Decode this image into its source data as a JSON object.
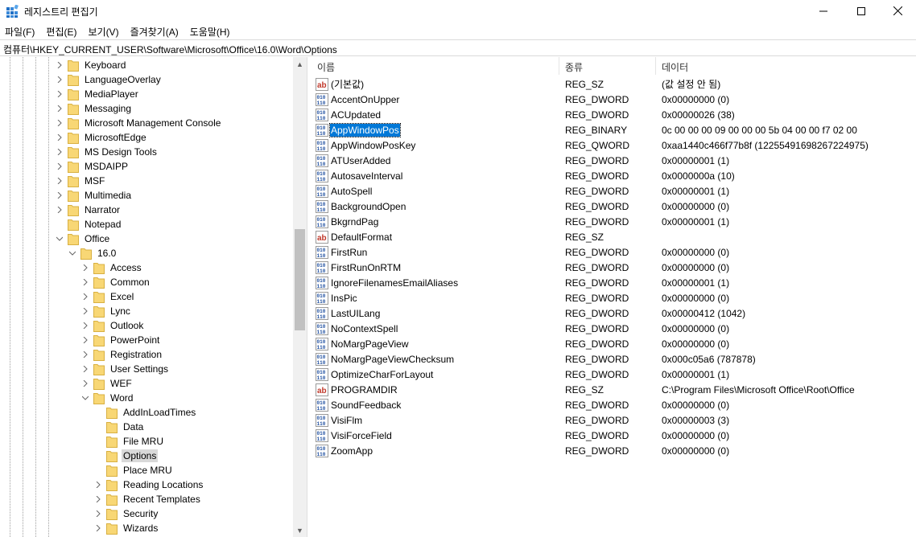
{
  "window": {
    "title": "레지스트리 편집기"
  },
  "menu": {
    "items": [
      "파일(F)",
      "편집(E)",
      "보기(V)",
      "즐겨찾기(A)",
      "도움말(H)"
    ]
  },
  "address": "컴퓨터\\HKEY_CURRENT_USER\\Software\\Microsoft\\Office\\16.0\\Word\\Options",
  "tree": {
    "items": [
      {
        "label": "Keyboard",
        "level": 0,
        "expander": "collapsed"
      },
      {
        "label": "LanguageOverlay",
        "level": 0,
        "expander": "collapsed"
      },
      {
        "label": "MediaPlayer",
        "level": 0,
        "expander": "collapsed"
      },
      {
        "label": "Messaging",
        "level": 0,
        "expander": "collapsed"
      },
      {
        "label": "Microsoft Management Console",
        "level": 0,
        "expander": "collapsed"
      },
      {
        "label": "MicrosoftEdge",
        "level": 0,
        "expander": "collapsed"
      },
      {
        "label": "MS Design Tools",
        "level": 0,
        "expander": "collapsed"
      },
      {
        "label": "MSDAIPP",
        "level": 0,
        "expander": "collapsed"
      },
      {
        "label": "MSF",
        "level": 0,
        "expander": "collapsed"
      },
      {
        "label": "Multimedia",
        "level": 0,
        "expander": "collapsed"
      },
      {
        "label": "Narrator",
        "level": 0,
        "expander": "collapsed"
      },
      {
        "label": "Notepad",
        "level": 0,
        "expander": "none"
      },
      {
        "label": "Office",
        "level": 0,
        "expander": "expanded"
      },
      {
        "label": "16.0",
        "level": 1,
        "expander": "expanded"
      },
      {
        "label": "Access",
        "level": 2,
        "expander": "collapsed"
      },
      {
        "label": "Common",
        "level": 2,
        "expander": "collapsed"
      },
      {
        "label": "Excel",
        "level": 2,
        "expander": "collapsed"
      },
      {
        "label": "Lync",
        "level": 2,
        "expander": "collapsed"
      },
      {
        "label": "Outlook",
        "level": 2,
        "expander": "collapsed"
      },
      {
        "label": "PowerPoint",
        "level": 2,
        "expander": "collapsed"
      },
      {
        "label": "Registration",
        "level": 2,
        "expander": "collapsed"
      },
      {
        "label": "User Settings",
        "level": 2,
        "expander": "collapsed"
      },
      {
        "label": "WEF",
        "level": 2,
        "expander": "collapsed"
      },
      {
        "label": "Word",
        "level": 2,
        "expander": "expanded"
      },
      {
        "label": "AddInLoadTimes",
        "level": 3,
        "expander": "none"
      },
      {
        "label": "Data",
        "level": 3,
        "expander": "none"
      },
      {
        "label": "File MRU",
        "level": 3,
        "expander": "none"
      },
      {
        "label": "Options",
        "level": 3,
        "expander": "none",
        "selected": true
      },
      {
        "label": "Place MRU",
        "level": 3,
        "expander": "none"
      },
      {
        "label": "Reading Locations",
        "level": 3,
        "expander": "collapsed"
      },
      {
        "label": "Recent Templates",
        "level": 3,
        "expander": "collapsed"
      },
      {
        "label": "Security",
        "level": 3,
        "expander": "collapsed"
      },
      {
        "label": "Wizards",
        "level": 3,
        "expander": "collapsed"
      }
    ]
  },
  "list": {
    "headers": {
      "name": "이름",
      "type": "종류",
      "data": "데이터"
    },
    "rows": [
      {
        "icon": "string-value-icon",
        "name": "(기본값)",
        "type": "REG_SZ",
        "data": "(값 설정 안 됨)"
      },
      {
        "icon": "binary-value-icon",
        "name": "AccentOnUpper",
        "type": "REG_DWORD",
        "data": "0x00000000 (0)"
      },
      {
        "icon": "binary-value-icon",
        "name": "ACUpdated",
        "type": "REG_DWORD",
        "data": "0x00000026 (38)"
      },
      {
        "icon": "binary-value-icon",
        "name": "AppWindowPos",
        "type": "REG_BINARY",
        "data": "0c 00 00 00 09 00 00 00 5b 04 00 00 f7 02 00",
        "selected": true
      },
      {
        "icon": "binary-value-icon",
        "name": "AppWindowPosKey",
        "type": "REG_QWORD",
        "data": "0xaa1440c466f77b8f (12255491698267224975)"
      },
      {
        "icon": "binary-value-icon",
        "name": "ATUserAdded",
        "type": "REG_DWORD",
        "data": "0x00000001 (1)"
      },
      {
        "icon": "binary-value-icon",
        "name": "AutosaveInterval",
        "type": "REG_DWORD",
        "data": "0x0000000a (10)"
      },
      {
        "icon": "binary-value-icon",
        "name": "AutoSpell",
        "type": "REG_DWORD",
        "data": "0x00000001 (1)"
      },
      {
        "icon": "binary-value-icon",
        "name": "BackgroundOpen",
        "type": "REG_DWORD",
        "data": "0x00000000 (0)"
      },
      {
        "icon": "binary-value-icon",
        "name": "BkgrndPag",
        "type": "REG_DWORD",
        "data": "0x00000001 (1)"
      },
      {
        "icon": "string-value-icon",
        "name": "DefaultFormat",
        "type": "REG_SZ",
        "data": ""
      },
      {
        "icon": "binary-value-icon",
        "name": "FirstRun",
        "type": "REG_DWORD",
        "data": "0x00000000 (0)"
      },
      {
        "icon": "binary-value-icon",
        "name": "FirstRunOnRTM",
        "type": "REG_DWORD",
        "data": "0x00000000 (0)"
      },
      {
        "icon": "binary-value-icon",
        "name": "IgnoreFilenamesEmailAliases",
        "type": "REG_DWORD",
        "data": "0x00000001 (1)"
      },
      {
        "icon": "binary-value-icon",
        "name": "InsPic",
        "type": "REG_DWORD",
        "data": "0x00000000 (0)"
      },
      {
        "icon": "binary-value-icon",
        "name": "LastUILang",
        "type": "REG_DWORD",
        "data": "0x00000412 (1042)"
      },
      {
        "icon": "binary-value-icon",
        "name": "NoContextSpell",
        "type": "REG_DWORD",
        "data": "0x00000000 (0)"
      },
      {
        "icon": "binary-value-icon",
        "name": "NoMargPageView",
        "type": "REG_DWORD",
        "data": "0x00000000 (0)"
      },
      {
        "icon": "binary-value-icon",
        "name": "NoMargPageViewChecksum",
        "type": "REG_DWORD",
        "data": "0x000c05a6 (787878)"
      },
      {
        "icon": "binary-value-icon",
        "name": "OptimizeCharForLayout",
        "type": "REG_DWORD",
        "data": "0x00000001 (1)"
      },
      {
        "icon": "string-value-icon",
        "name": "PROGRAMDIR",
        "type": "REG_SZ",
        "data": "C:\\Program Files\\Microsoft Office\\Root\\Office"
      },
      {
        "icon": "binary-value-icon",
        "name": "SoundFeedback",
        "type": "REG_DWORD",
        "data": "0x00000000 (0)"
      },
      {
        "icon": "binary-value-icon",
        "name": "VisiFlm",
        "type": "REG_DWORD",
        "data": "0x00000003 (3)"
      },
      {
        "icon": "binary-value-icon",
        "name": "VisiForceField",
        "type": "REG_DWORD",
        "data": "0x00000000 (0)"
      },
      {
        "icon": "binary-value-icon",
        "name": "ZoomApp",
        "type": "REG_DWORD",
        "data": "0x00000000 (0)"
      }
    ]
  },
  "colors": {
    "selection": "#0078d7",
    "tree_selection": "#d9d9d9",
    "folder": "#f8d775"
  }
}
